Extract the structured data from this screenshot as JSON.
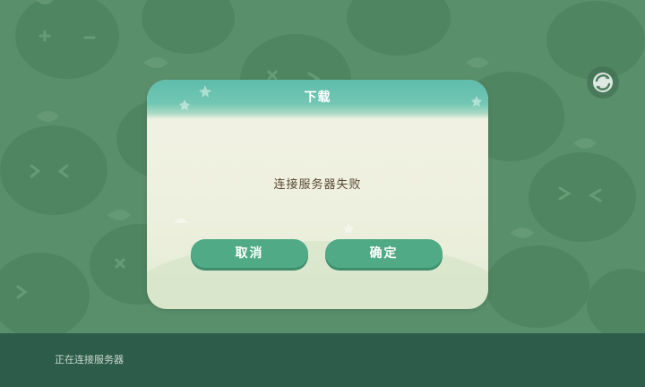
{
  "dialog": {
    "title": "下载",
    "message": "连接服务器失败",
    "cancel_label": "取消",
    "confirm_label": "确定"
  },
  "status_bar": {
    "text": "正在连接服务器"
  },
  "icons": {
    "sync": "sync-icon"
  },
  "colors": {
    "background": "#5a8f6c",
    "bottom_bar": "#2e5c4a",
    "dialog_header": "#5fbcab",
    "button": "#4faa85",
    "message_text": "#5a4632"
  }
}
